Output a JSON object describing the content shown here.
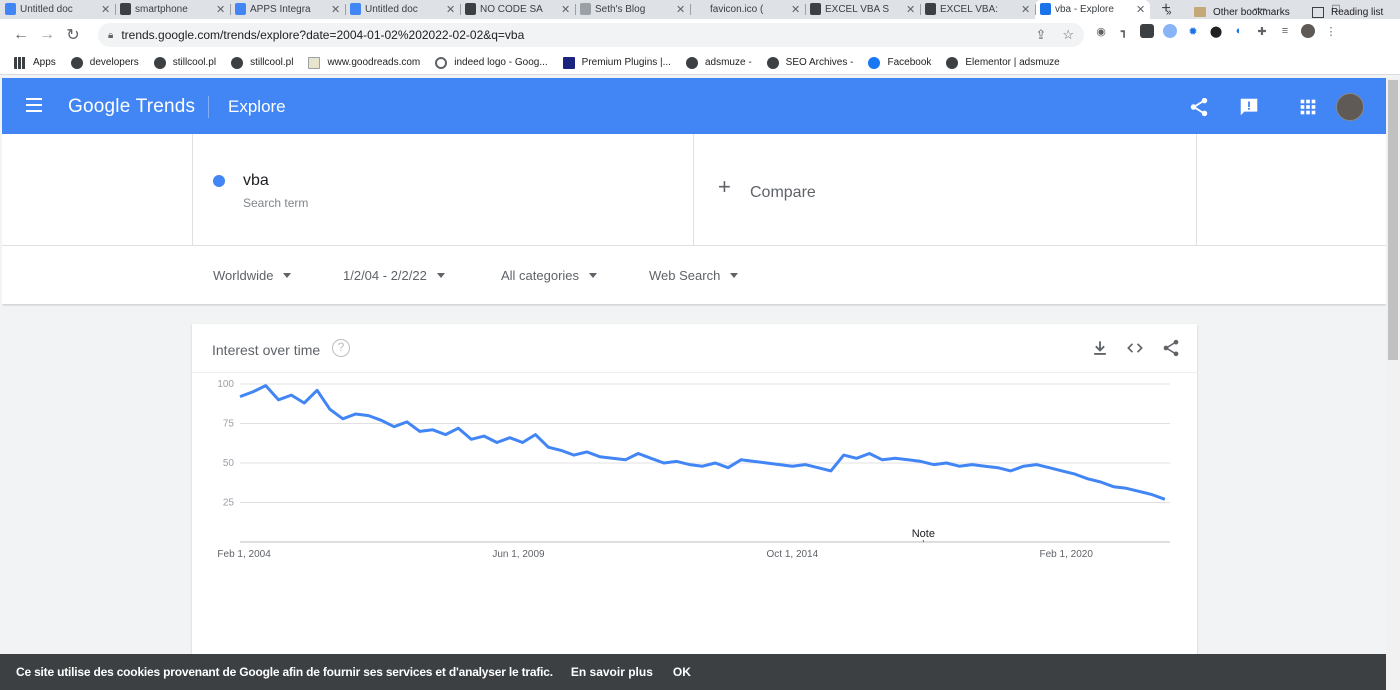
{
  "browser": {
    "tabs": [
      {
        "title": "Untitled doc",
        "favicon_color": "#4285f4",
        "active": false
      },
      {
        "title": "smartphone",
        "favicon_color": "#3c4043",
        "active": false
      },
      {
        "title": "APPS Integra",
        "favicon_color": "#4285f4",
        "active": false
      },
      {
        "title": "Untitled doc",
        "favicon_color": "#4285f4",
        "active": false
      },
      {
        "title": "NO CODE SA",
        "favicon_color": "#3c4043",
        "active": false
      },
      {
        "title": "Seth's Blog",
        "favicon_color": "#9aa0a6",
        "active": false
      },
      {
        "title": "favicon.ico (",
        "favicon_color": "#dee1e6",
        "active": false
      },
      {
        "title": "EXCEL VBA S",
        "favicon_color": "#3c4043",
        "active": false
      },
      {
        "title": "EXCEL VBA:",
        "favicon_color": "#3c4043",
        "active": false
      },
      {
        "title": "vba - Explore",
        "favicon_color": "#1a73e8",
        "active": true
      }
    ],
    "newtab": "+",
    "url": "trends.google.com/trends/explore?date=2004-01-02%202022-02-02&q=vba",
    "bookmarks": [
      {
        "label": "Apps",
        "icon": "apps-grid-icon"
      },
      {
        "label": "developers",
        "icon": "globe-icon"
      },
      {
        "label": "stillcool.pl",
        "icon": "globe-icon"
      },
      {
        "label": "stillcool.pl",
        "icon": "globe-icon"
      },
      {
        "label": "www.goodreads.com",
        "icon": "goodreads-icon"
      },
      {
        "label": "indeed logo - Goog...",
        "icon": "google-icon"
      },
      {
        "label": "Premium Plugins |...",
        "icon": "hd-icon"
      },
      {
        "label": "adsmuze -",
        "icon": "globe-icon"
      },
      {
        "label": "SEO Archives -",
        "icon": "globe-icon"
      },
      {
        "label": "Facebook",
        "icon": "facebook-icon"
      },
      {
        "label": "Elementor | adsmuze",
        "icon": "globe-icon"
      }
    ],
    "overflow": "»",
    "other_bookmarks": "Other bookmarks",
    "reading_list": "Reading list"
  },
  "header": {
    "logo": "Google Trends",
    "section": "Explore"
  },
  "search": {
    "term": "vba",
    "term_label": "Search term",
    "term_color": "#4285f4",
    "compare": "Compare"
  },
  "filters": {
    "region": "Worldwide",
    "dates": "1/2/04 - 2/2/22",
    "category": "All categories",
    "property": "Web Search"
  },
  "card": {
    "title": "Interest over time"
  },
  "chart_data": {
    "type": "line",
    "title": "Interest over time",
    "xlabel": "",
    "ylabel": "",
    "ylim": [
      0,
      100
    ],
    "yticks": [
      25,
      50,
      75,
      100
    ],
    "xticks": [
      "Feb 1, 2004",
      "Jun 1, 2009",
      "Oct 1, 2014",
      "Feb 1, 2020"
    ],
    "xrange": [
      2004.0,
      2022.1
    ],
    "annotation": "Note",
    "series": [
      {
        "color": "#4285f4",
        "x": [
          2004.0,
          2004.25,
          2004.5,
          2004.75,
          2005.0,
          2005.25,
          2005.5,
          2005.75,
          2006.0,
          2006.25,
          2006.5,
          2006.75,
          2007.0,
          2007.25,
          2007.5,
          2007.75,
          2008.0,
          2008.25,
          2008.5,
          2008.75,
          2009.0,
          2009.25,
          2009.5,
          2009.75,
          2010.0,
          2010.25,
          2010.5,
          2010.75,
          2011.0,
          2011.25,
          2011.5,
          2011.75,
          2012.0,
          2012.25,
          2012.5,
          2012.75,
          2013.0,
          2013.25,
          2013.5,
          2013.75,
          2014.0,
          2014.25,
          2014.5,
          2014.75,
          2015.0,
          2015.25,
          2015.5,
          2015.75,
          2016.0,
          2016.25,
          2016.5,
          2016.75,
          2017.0,
          2017.25,
          2017.5,
          2017.75,
          2018.0,
          2018.25,
          2018.5,
          2018.75,
          2019.0,
          2019.25,
          2019.5,
          2019.75,
          2020.0,
          2020.25,
          2020.5,
          2020.75,
          2021.0,
          2021.25,
          2021.5,
          2021.75,
          2022.0
        ],
        "values": [
          92,
          95,
          99,
          90,
          93,
          88,
          96,
          84,
          78,
          81,
          80,
          77,
          73,
          76,
          70,
          71,
          68,
          72,
          65,
          67,
          63,
          66,
          63,
          68,
          60,
          58,
          55,
          57,
          54,
          53,
          52,
          56,
          53,
          50,
          51,
          49,
          48,
          50,
          47,
          52,
          51,
          50,
          49,
          48,
          49,
          47,
          45,
          55,
          53,
          56,
          52,
          53,
          52,
          51,
          49,
          50,
          48,
          49,
          48,
          47,
          45,
          48,
          49,
          47,
          45,
          43,
          40,
          38,
          35,
          34,
          32,
          30,
          27
        ]
      }
    ]
  },
  "cookie": {
    "text": "Ce site utilise des cookies provenant de Google afin de fournir ses services et d'analyser le trafic.",
    "learn_more": "En savoir plus",
    "ok": "OK"
  }
}
